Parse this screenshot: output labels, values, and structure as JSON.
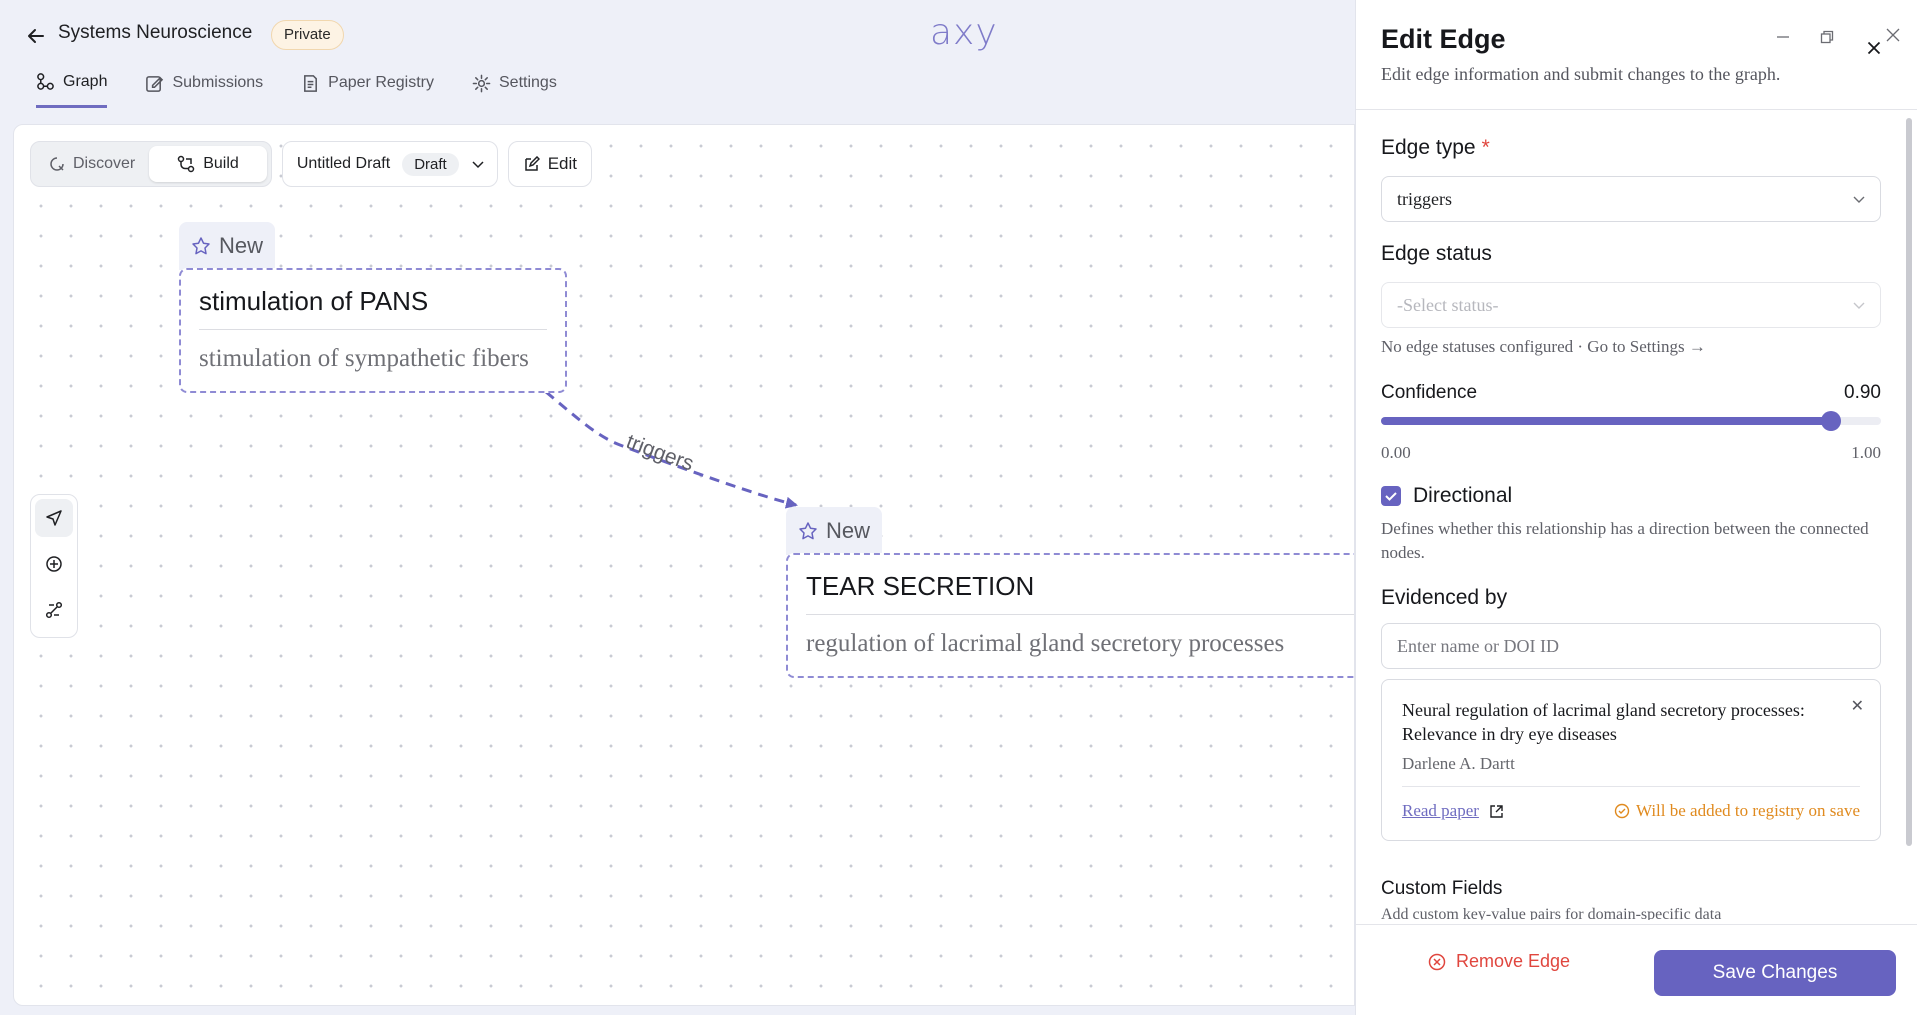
{
  "header": {
    "project_title": "Systems Neuroscience",
    "visibility_badge": "Private",
    "logo_text": "axy",
    "tabs": [
      {
        "label": "Graph",
        "icon": "graph-icon"
      },
      {
        "label": "Submissions",
        "icon": "submissions-icon"
      },
      {
        "label": "Paper Registry",
        "icon": "paper-registry-icon"
      },
      {
        "label": "Settings",
        "icon": "gear-icon"
      }
    ],
    "active_tab": "Graph"
  },
  "toolbar": {
    "discover_label": "Discover",
    "build_label": "Build",
    "active_mode": "Build",
    "draft_name": "Untitled Draft",
    "draft_status": "Draft",
    "edit_label": "Edit"
  },
  "side_tools": [
    "navigate-icon",
    "add-node-icon",
    "connect-icon"
  ],
  "graph": {
    "nodes": [
      {
        "tag": "New",
        "title": "stimulation of PANS",
        "subtitle": "stimulation of sympathetic fibers"
      },
      {
        "tag": "New",
        "title": "TEAR SECRETION",
        "subtitle": "regulation of lacrimal gland secretory processes"
      }
    ],
    "edge_label": "triggers"
  },
  "panel": {
    "title": "Edit Edge",
    "subtitle": "Edit edge information and submit changes to the graph.",
    "edge_type": {
      "label": "Edge type",
      "required_mark": "*",
      "value": "triggers"
    },
    "edge_status": {
      "label": "Edge status",
      "placeholder": "-Select status-",
      "hint": "No edge statuses configured · Go to Settings →"
    },
    "confidence": {
      "label": "Confidence",
      "value": "0.90",
      "min": "0.00",
      "max": "1.00",
      "fraction": 0.9
    },
    "directional": {
      "label": "Directional",
      "checked": true,
      "description": "Defines whether this relationship has a direction between the connected nodes."
    },
    "evidenced_by": {
      "label": "Evidenced by",
      "placeholder": "Enter name or DOI ID",
      "paper": {
        "title": "Neural regulation of lacrimal gland secretory processes: Relevance in dry eye diseases",
        "author": "Darlene A. Dartt",
        "link_label": "Read paper",
        "note": "Will be added to registry on save"
      }
    },
    "custom_fields": {
      "label": "Custom Fields",
      "description": "Add custom key-value pairs for domain-specific data"
    },
    "remove_label": "Remove Edge",
    "save_label": "Save Changes"
  },
  "colors": {
    "accent": "#6763c0",
    "danger": "#e0463e",
    "warning": "#e08a1e",
    "badge_bg": "#fdf3e4"
  }
}
